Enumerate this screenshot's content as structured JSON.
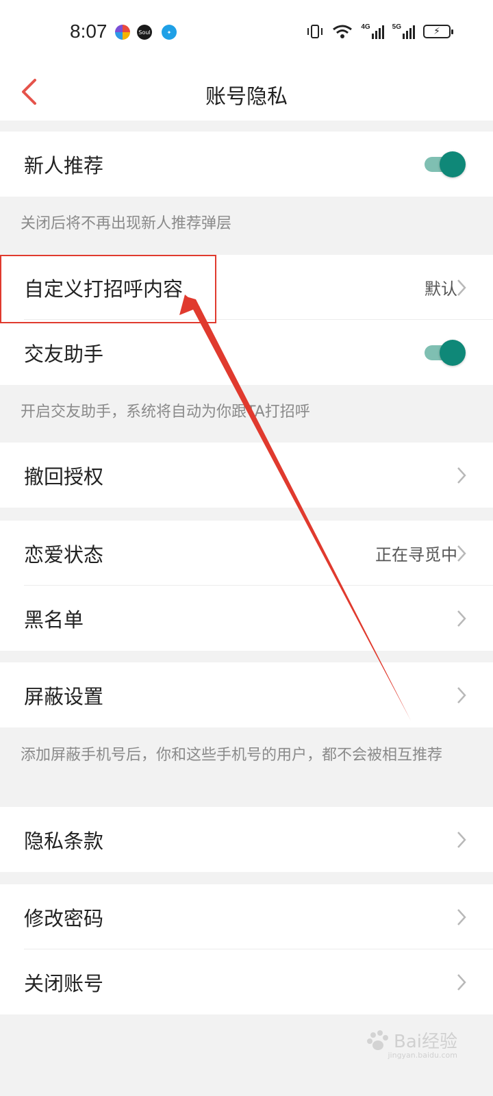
{
  "status_bar": {
    "time": "8:07",
    "network_left": "4G",
    "network_right": "5G",
    "app_icon_2_text": "Soul"
  },
  "nav": {
    "title": "账号隐私"
  },
  "settings": {
    "new_person_recommend": {
      "label": "新人推荐",
      "toggle_on": true
    },
    "new_person_hint": "关闭后将不再出现新人推荐弹层",
    "custom_greeting": {
      "label": "自定义打招呼内容",
      "value": "默认"
    },
    "friend_assistant": {
      "label": "交友助手",
      "toggle_on": true
    },
    "friend_assistant_hint": "开启交友助手，系统将自动为你跟TA打招呼",
    "revoke_auth": {
      "label": "撤回授权"
    },
    "love_status": {
      "label": "恋爱状态",
      "value": "正在寻觅中"
    },
    "blacklist": {
      "label": "黑名单"
    },
    "block_settings": {
      "label": "屏蔽设置"
    },
    "block_hint": "添加屏蔽手机号后，你和这些手机号的用户，都不会被相互推荐",
    "privacy_terms": {
      "label": "隐私条款"
    },
    "change_password": {
      "label": "修改密码"
    },
    "close_account": {
      "label": "关闭账号"
    }
  },
  "watermark": {
    "text": "Bai经验",
    "sub": "jingyan.baidu.com"
  },
  "colors": {
    "accent_red": "#e03a2e",
    "toggle_on": "#0f8878",
    "toggle_track": "#7fbfb2",
    "back_arrow": "#e5534b"
  }
}
